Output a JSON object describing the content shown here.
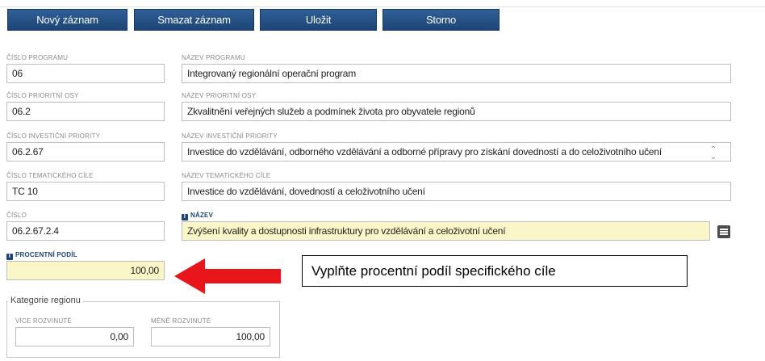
{
  "toolbar": {
    "new_record": "Nový záznam",
    "delete_record": "Smazat záznam",
    "save": "Uložit",
    "cancel": "Storno"
  },
  "form": {
    "program_number": {
      "label": "ČÍSLO PROGRAMU",
      "value": "06"
    },
    "program_name": {
      "label": "NÁZEV PROGRAMU",
      "value": "Integrovaný regionální operační program"
    },
    "priority_axis_number": {
      "label": "ČÍSLO PRIORITNÍ OSY",
      "value": "06.2"
    },
    "priority_axis_name": {
      "label": "NÁZEV PRIORITNÍ OSY",
      "value": "Zkvalitnění veřejných služeb a podmínek života pro obyvatele regionů"
    },
    "investment_priority_number": {
      "label": "ČÍSLO INVESTIČNÍ PRIORITY",
      "value": "06.2.67"
    },
    "investment_priority_name": {
      "label": "NÁZEV INVESTIČNÍ PRIORITY",
      "value": "Investice do vzdělávání, odborného vzdělávání a odborné přípravy pro získání dovedností a do celoživotního učení"
    },
    "thematic_goal_number": {
      "label": "ČÍSLO TEMATICKÉHO CÍLE",
      "value": "TC 10"
    },
    "thematic_goal_name": {
      "label": "NÁZEV TEMATICKÉHO CÍLE",
      "value": "Investice do vzdělávání, dovedností a celoživotního učení"
    },
    "number": {
      "label": "ČÍSLO",
      "value": "06.2.67.2.4"
    },
    "name": {
      "label": "NÁZEV",
      "value": "Zvýšení kvality a dostupnosti infrastruktury pro vzdělávání a celoživotní učení"
    },
    "percentage_share": {
      "label": "PROCENTNÍ PODÍL",
      "value": "100,00"
    }
  },
  "callout": {
    "text": "Vyplňte procentní podíl specifického cíle"
  },
  "region_category": {
    "legend": "Kategorie regionu",
    "more_developed": {
      "label": "VÍCE ROZVINUTÉ",
      "value": "0,00"
    },
    "less_developed": {
      "label": "MÉNĚ ROZVINUTÉ",
      "value": "100,00"
    }
  },
  "icons": {
    "info": "info-icon",
    "menu": "list-menu-icon",
    "scroll": "scroll-updown-icon",
    "arrow": "red-arrow-left"
  },
  "colors": {
    "button_bg": "#1e4576",
    "required_field_bg": "#fbf6c8",
    "arrow": "#e8151b"
  }
}
